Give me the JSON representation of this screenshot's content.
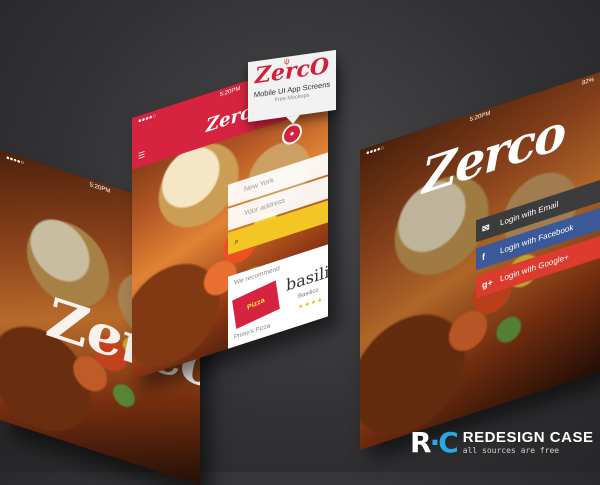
{
  "tag": {
    "logo": "ZercO",
    "line1": "Mobile UI App Screens",
    "line2": "Free Mockups"
  },
  "status": {
    "carrier": "●●●●○",
    "time": "5:20PM",
    "battery": "82%"
  },
  "screen1": {
    "brand": "Zerco"
  },
  "screen2": {
    "brand": "Zerco",
    "city_placeholder": "New York",
    "address_placeholder": "Your address",
    "recommend_title": "We recommend",
    "pizza_logo": "Pizza",
    "basil": "basili",
    "place1": "Primo's Pizza",
    "place2": "Basilico",
    "stars": "★★★★"
  },
  "screen3": {
    "brand": "Zerco",
    "login_email": "Login with Email",
    "login_facebook": "Login with Facebook",
    "login_google": "Login with Google+"
  },
  "footer": {
    "mark_r": "R",
    "mark_c": "C",
    "title": "REDESIGN CASE",
    "subtitle": "all sources are free"
  },
  "colors": {
    "brand_red": "#d6233f",
    "search_yellow": "#f3c623",
    "facebook": "#3b5998",
    "google": "#dc3b2e",
    "rc_blue": "#2aa8e0"
  }
}
